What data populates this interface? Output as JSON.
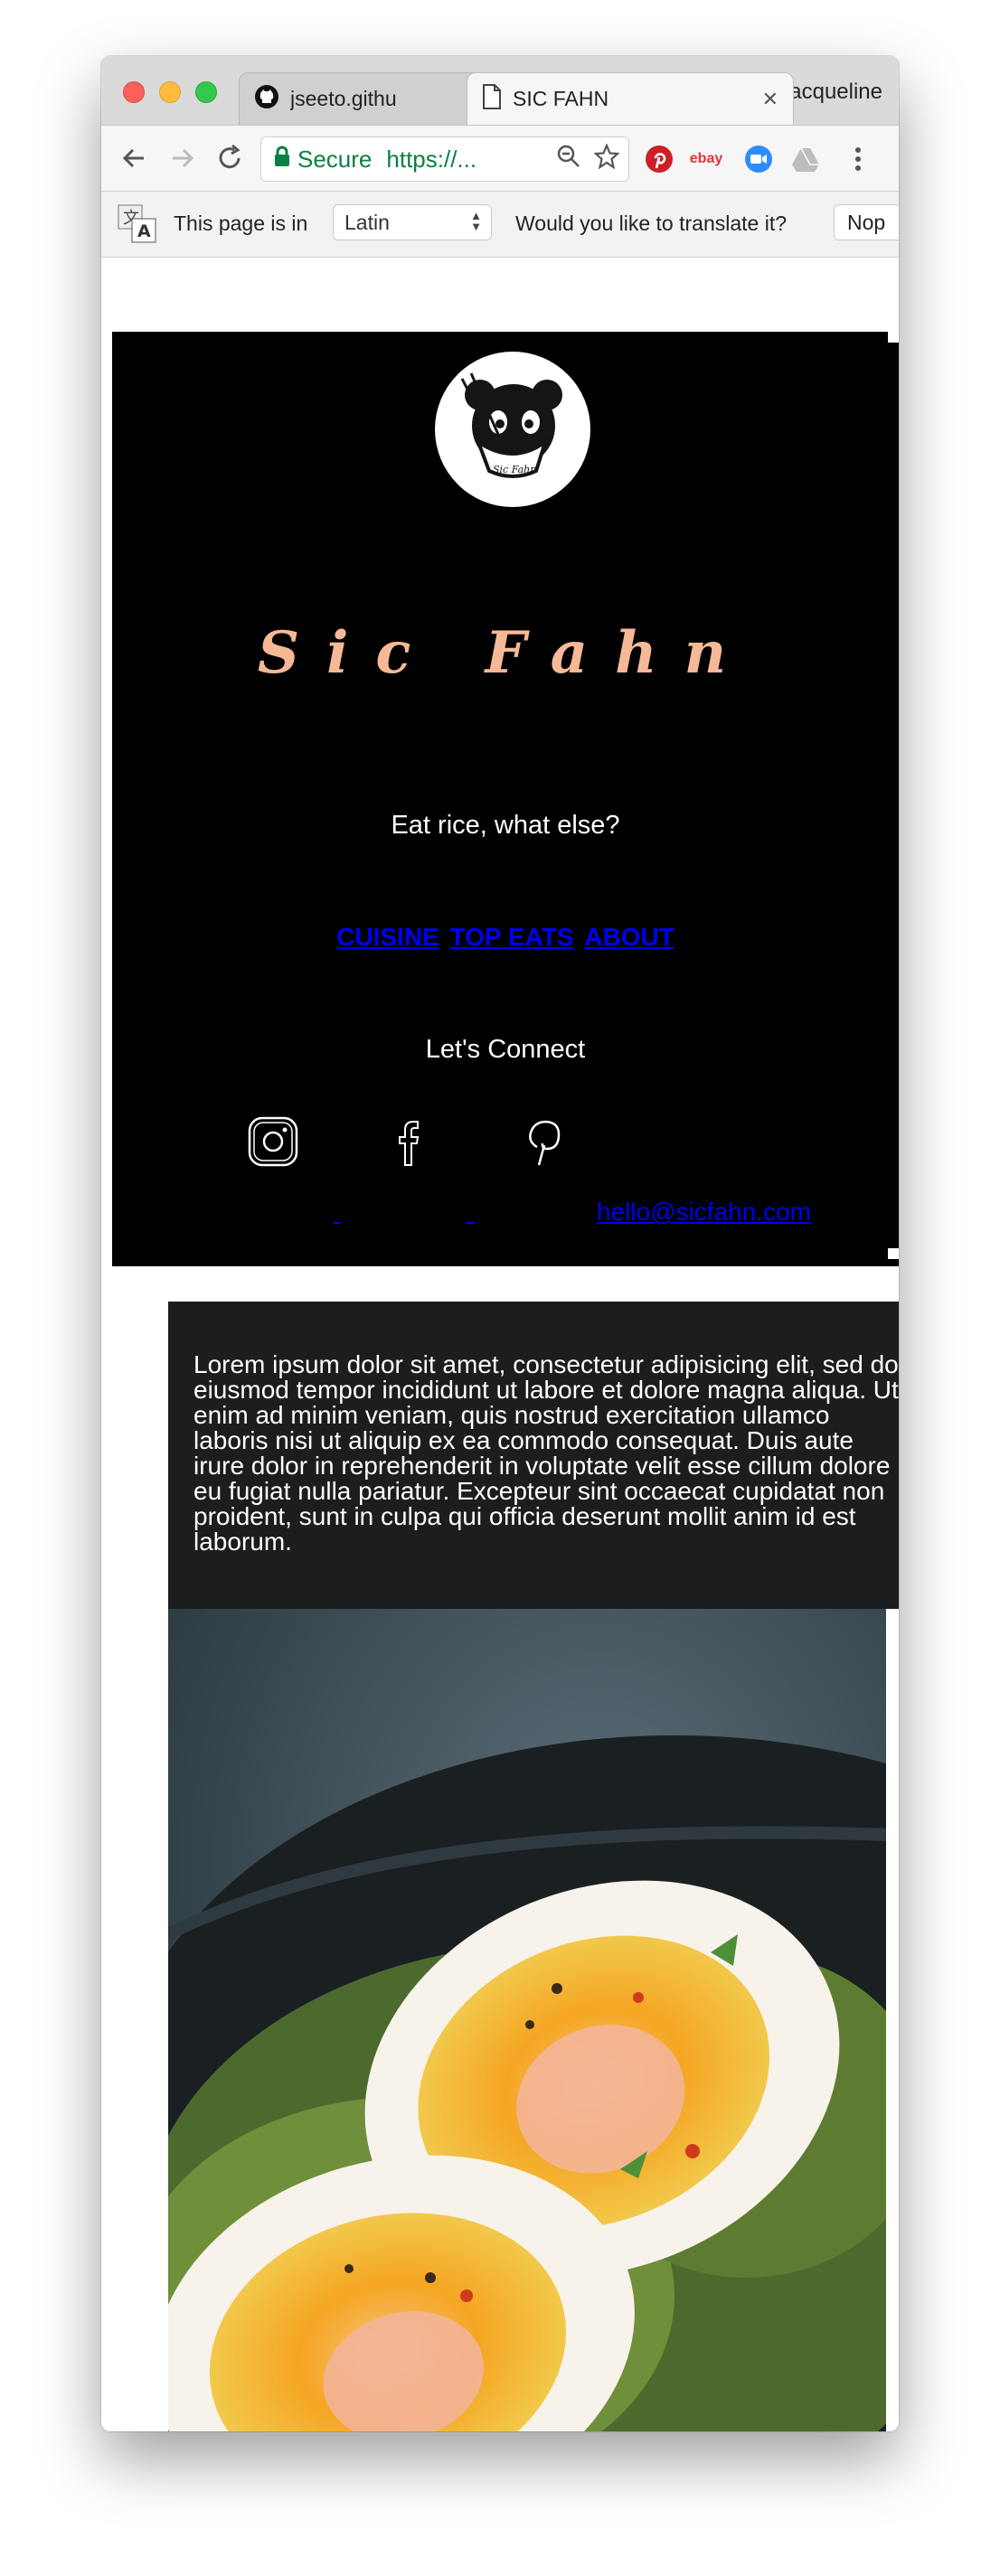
{
  "browser": {
    "tabs": [
      {
        "title": "jseeto.githu",
        "icon": "github-icon"
      },
      {
        "title": "SIC FAHN",
        "icon": "document-icon"
      }
    ],
    "profile_name": "Jacqueline",
    "address": {
      "security_label": "Secure",
      "url": "https://..."
    },
    "extensions": [
      "pinterest-icon",
      "ebay-icon",
      "zoom-icon",
      "drive-icon"
    ],
    "ebay_label": "ebay"
  },
  "translate_bar": {
    "prefix": "This page is in",
    "language": "Latin",
    "question": "Would you like to translate it?",
    "decline_label": "Nop"
  },
  "site": {
    "brand": "Sic Fahn",
    "tagline": "Eat rice, what else?",
    "nav": [
      "CUISINE",
      "TOP EATS",
      "ABOUT"
    ],
    "connect_heading": "Let's Connect",
    "social": [
      "instagram-icon",
      "facebook-icon",
      "pinterest-icon"
    ],
    "email": "hello@sicfahn.com",
    "lorem": "Lorem ipsum dolor sit amet, consectetur adipisicing elit, sed do eiusmod tempor incididunt ut labore et dolore magna aliqua. Ut enim ad minim veniam, quis nostrud exercitation ullamco laboris nisi ut aliquip ex ea commodo consequat. Duis aute irure dolor in reprehenderit in voluptate velit esse cillum dolore eu fugiat nulla pariatur. Excepteur sint occaecat cupidatat non proident, sunt in culpa qui officia deserunt mollit anim id est laborum.",
    "colors": {
      "brand": "#f6b996",
      "link": "#0000ee",
      "background": "#000000",
      "panel": "#1b1d1e"
    }
  }
}
